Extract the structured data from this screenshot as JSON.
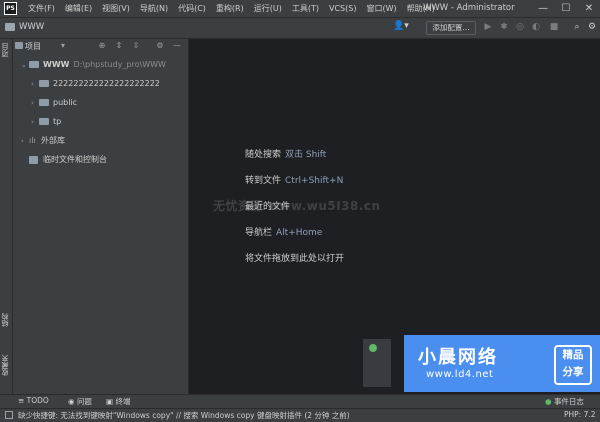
{
  "app": {
    "logo": "PS",
    "window_title": "WWW - Administrator"
  },
  "menu": [
    "文件(F)",
    "编辑(E)",
    "视图(V)",
    "导航(N)",
    "代码(C)",
    "重构(R)",
    "运行(U)",
    "工具(T)",
    "VCS(S)",
    "窗口(W)",
    "帮助(H)"
  ],
  "window_controls": {
    "minimize": "—",
    "maximize": "☐",
    "close": "✕"
  },
  "nav": {
    "crumb": "WWW",
    "add_config": "添加配置..."
  },
  "stripe": {
    "project": "项目",
    "structure": "结构",
    "favorites": "收藏夹"
  },
  "panel": {
    "title": "项目"
  },
  "tree": [
    {
      "label": "WWW",
      "path": "D:\\phpstudy_pro\\WWW"
    },
    {
      "label": "222222222222222222222"
    },
    {
      "label": "public"
    },
    {
      "label": "tp"
    },
    {
      "label": "外部库"
    },
    {
      "label": "临时文件和控制台"
    }
  ],
  "hints": [
    {
      "action": "随处搜索",
      "key": "双击 Shift"
    },
    {
      "action": "转到文件",
      "key": "Ctrl+Shift+N"
    },
    {
      "action": "最近的文件",
      "key": ""
    },
    {
      "action": "导航栏",
      "key": "Alt+Home"
    },
    {
      "action": "将文件拖放到此处以打开",
      "key": ""
    }
  ],
  "watermark": "无忧资源 www.wu5I38.cn",
  "brand": {
    "name": "小晨网络",
    "url": "www.ld4.net",
    "tag_line1": "精品",
    "tag_line2": "分享"
  },
  "bottom_tools": {
    "todo": "TODO",
    "problems": "问题",
    "terminal": "终端",
    "event_log": "事件日志"
  },
  "status": {
    "message": "缺少快捷键: 无法找到键映射\"Windows copy\" // 搜索 Windows copy 键盘映射插件 (2 分钟 之前)",
    "php": "PHP: 7.2"
  }
}
